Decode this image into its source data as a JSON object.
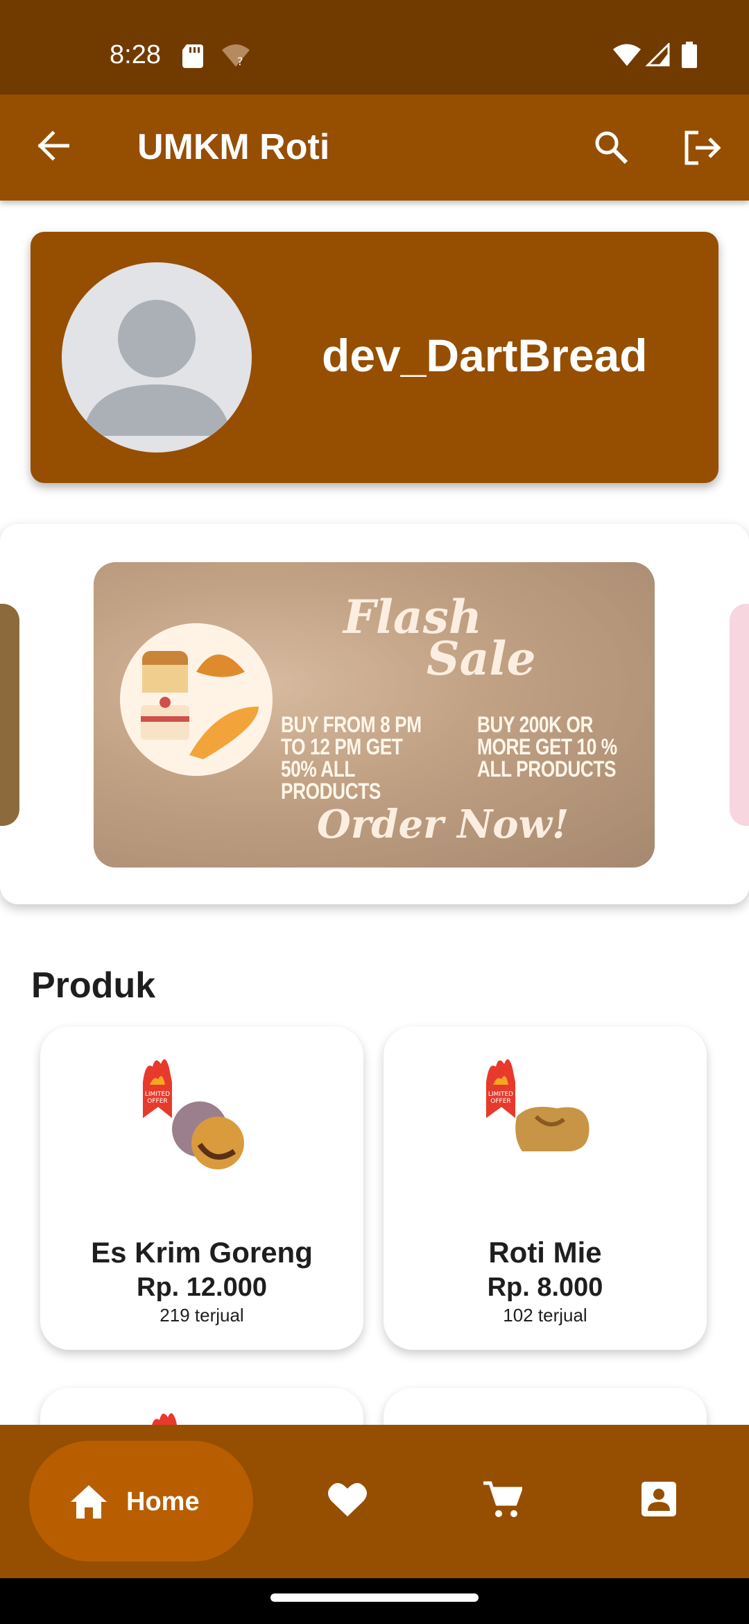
{
  "status_bar": {
    "time": "8:28",
    "icons": [
      "sd-card-icon",
      "wifi-question-icon",
      "wifi-icon",
      "signal-icon",
      "battery-icon"
    ]
  },
  "app_bar": {
    "title": "UMKM Roti",
    "icons": [
      "back-arrow-icon",
      "search-icon",
      "logout-icon"
    ]
  },
  "profile": {
    "username": "dev_DartBread"
  },
  "banner": {
    "title_line1": "Flash",
    "title_line2": "Sale",
    "promo_1": "BUY FROM 8 PM TO 12 PM GET 50% ALL PRODUCTS",
    "promo_2": "BUY 200K OR MORE GET 10 % ALL PRODUCTS",
    "cta": "Order Now!"
  },
  "products": {
    "section_title": "Produk",
    "items": [
      {
        "name": "Es Krim Goreng",
        "price": "Rp. 12.000",
        "sold": "219 terjual"
      },
      {
        "name": "Roti Mie",
        "price": "Rp. 8.000",
        "sold": "102 terjual"
      }
    ]
  },
  "bottom_nav": {
    "home_label": "Home",
    "icons": [
      "home-icon",
      "heart-icon",
      "cart-icon",
      "profile-icon"
    ]
  },
  "colors": {
    "status_bar": "#713b00",
    "app_bar": "#964e00",
    "nav_active": "#b85e00"
  }
}
